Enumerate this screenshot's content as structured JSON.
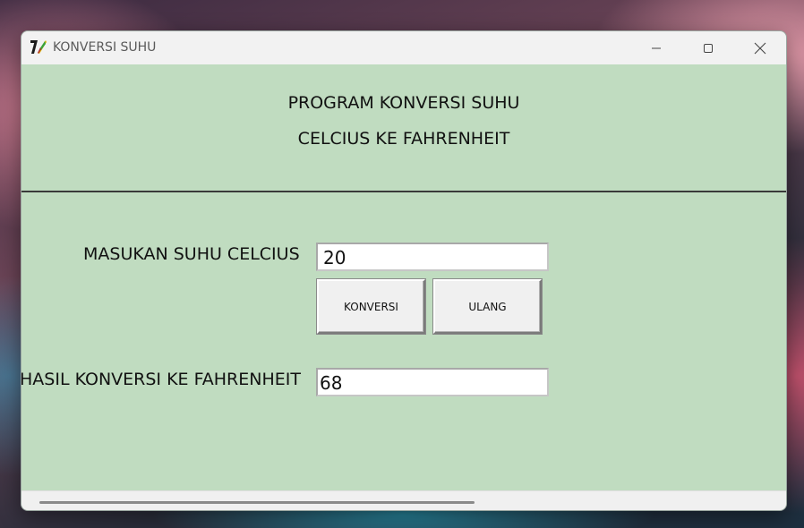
{
  "window": {
    "title": "KONVERSI SUHU",
    "icon": "tk-feather-icon"
  },
  "controls": {
    "minimize": "minimize-icon",
    "maximize": "maximize-icon",
    "close": "close-icon"
  },
  "header": {
    "line1": "PROGRAM KONVERSI SUHU",
    "line2": "CELCIUS KE FAHRENHEIT"
  },
  "form": {
    "celcius_label": "MASUKAN SUHU CELCIUS",
    "celcius_value": "20",
    "konversi_button": "KONVERSI",
    "ulang_button": "ULANG",
    "hasil_label": "HASIL KONVERSI KE FAHRENHEIT",
    "hasil_value": "68"
  },
  "colors": {
    "window_background": "#c0dcc0",
    "titlebar": "#f2f2f2"
  }
}
